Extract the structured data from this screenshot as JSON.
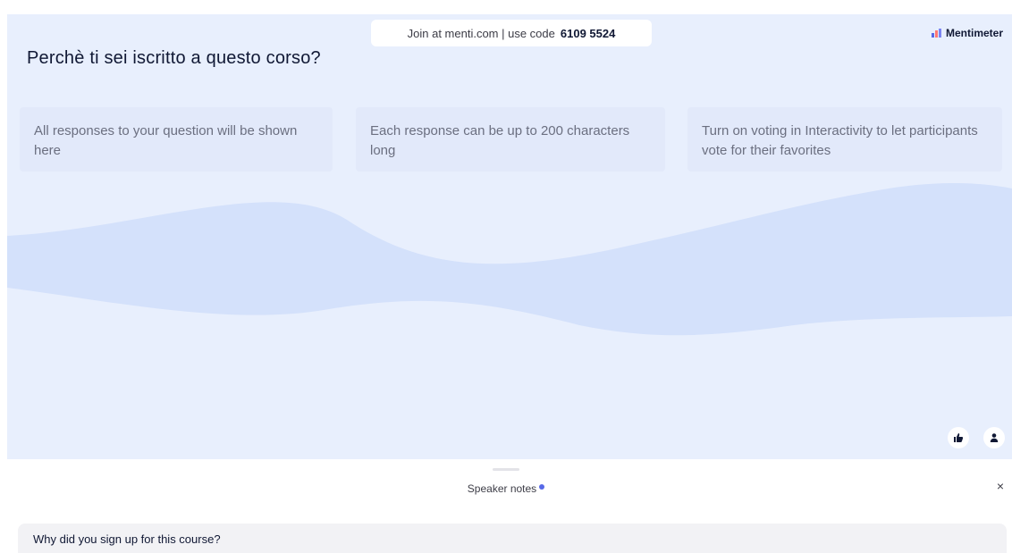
{
  "header": {
    "join_text": "Join at menti.com | use code",
    "join_code": "6109 5524",
    "brand_name": "Mentimeter"
  },
  "slide": {
    "question": "Perchè ti sei iscritto a questo corso?",
    "cards": [
      {
        "text": "All responses to your question will be shown here"
      },
      {
        "text": "Each response can be up to 200 characters long"
      },
      {
        "text": "Turn on voting in Interactivity to let participants vote for their favorites"
      }
    ],
    "buttons": {
      "like_icon": "thumbs-up-icon",
      "person_icon": "person-icon"
    }
  },
  "notes": {
    "label": "Speaker notes",
    "close_label": "×",
    "text": "Why did you sign up for this course?"
  },
  "colors": {
    "slide_bg": "#e8effd",
    "wave": "#d4e1fb",
    "text_dark": "#101834",
    "accent_dot": "#5769e7"
  }
}
